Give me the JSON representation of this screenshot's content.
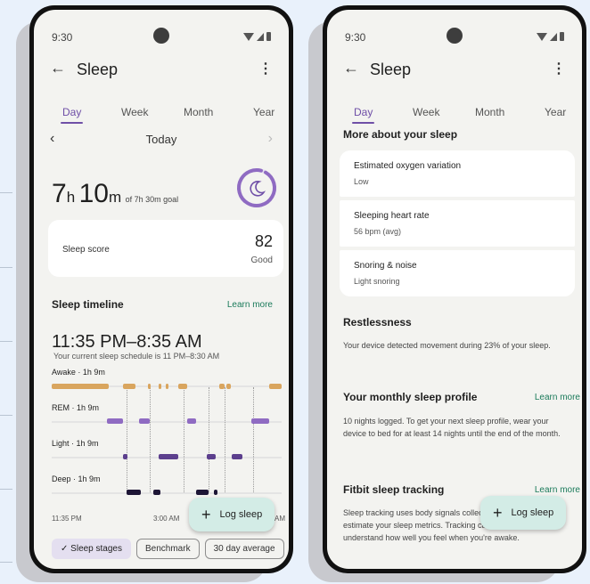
{
  "status": {
    "time": "9:30"
  },
  "left": {
    "app_title": "Sleep",
    "tabs": [
      "Day",
      "Week",
      "Month",
      "Year"
    ],
    "date_label": "Today",
    "duration": {
      "hours": "7",
      "h_unit": "h",
      "minutes": "10",
      "m_unit": "m",
      "goal": "of 7h 30m goal"
    },
    "score": {
      "label": "Sleep score",
      "value": "82",
      "rating": "Good"
    },
    "timeline": {
      "title": "Sleep timeline",
      "learn_more": "Learn more",
      "range": "11:35 PM–8:35 AM",
      "schedule": "Your current sleep schedule is 11 PM–8:30 AM",
      "stages": [
        {
          "label": "Awake · 1h 9m"
        },
        {
          "label": "REM · 1h 9m"
        },
        {
          "label": "Light · 1h 9m"
        },
        {
          "label": "Deep · 1h 9m"
        }
      ],
      "time_start": "11:35 PM",
      "time_mid": "3:00 AM",
      "time_end_partial": "AM"
    },
    "chips": [
      "Sleep stages",
      "Benchmark",
      "30 day average"
    ],
    "fab_label": "Log sleep"
  },
  "right": {
    "app_title": "Sleep",
    "tabs": [
      "Day",
      "Week",
      "Month",
      "Year"
    ],
    "more_title": "More about your sleep",
    "metrics": [
      {
        "title": "Estimated oxygen variation",
        "value": "Low"
      },
      {
        "title": "Sleeping heart rate",
        "value": "56 bpm (avg)"
      },
      {
        "title": "Snoring & noise",
        "value": "Light snoring"
      }
    ],
    "restless": {
      "title": "Restlessness",
      "text": "Your device detected movement during 23% of your sleep."
    },
    "monthly": {
      "title": "Your monthly sleep profile",
      "link": "Learn more",
      "text": "10 nights logged. To get your next sleep profile, wear your device to bed for at least 14 nights until the end of the month."
    },
    "fitbit": {
      "title": "Fitbit sleep tracking",
      "link": "Learn more",
      "text": "Sleep tracking uses body signals collected by your device to estimate your sleep metrics. Tracking can help you better understand how well you feel when you're awake."
    },
    "fab_label": "Log sleep"
  },
  "colors": {
    "accent": "#6f4fa7",
    "link": "#1a7a5a",
    "awake": "#d9a55e",
    "rem": "#8f6bc2",
    "light": "#5c3f8d",
    "deep": "#1d1535",
    "fab": "#d3ece6"
  }
}
